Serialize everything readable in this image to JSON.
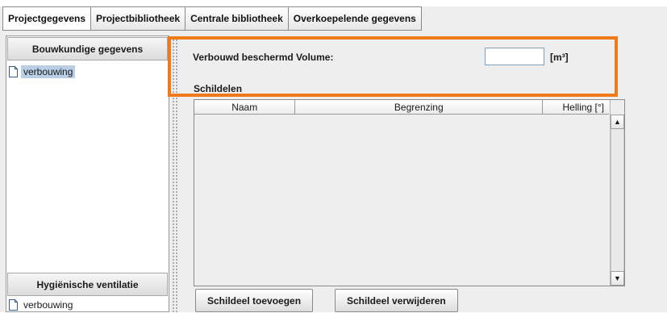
{
  "tabs": [
    {
      "label": "Projectgegevens"
    },
    {
      "label": "Projectbibliotheek"
    },
    {
      "label": "Centrale bibliotheek"
    },
    {
      "label": "Overkoepelende gegevens"
    }
  ],
  "left_panel": {
    "bouwkundig": {
      "header": "Bouwkundige gegevens",
      "items": [
        {
          "label": "verbouwing",
          "icon": "document-icon",
          "selected": true
        }
      ]
    },
    "ventilatie": {
      "header": "Hygiënische ventilatie",
      "items": [
        {
          "label": "verbouwing",
          "icon": "document-icon",
          "selected": false
        }
      ]
    }
  },
  "form": {
    "volume_label": "Verbouwd beschermd Volume:",
    "volume_value": "",
    "volume_unit": "[m³]"
  },
  "schildelen": {
    "label": "Schildelen",
    "columns": [
      "Naam",
      "Begrenzing",
      "Helling [°]"
    ],
    "rows": []
  },
  "scrollbar": {
    "up_icon": "▲",
    "down_icon": "▼"
  },
  "buttons": {
    "add": "Schildeel toevoegen",
    "remove": "Schildeel verwijderen"
  },
  "colors": {
    "highlight": "#f07a1a",
    "selection": "#b8cfe5"
  }
}
